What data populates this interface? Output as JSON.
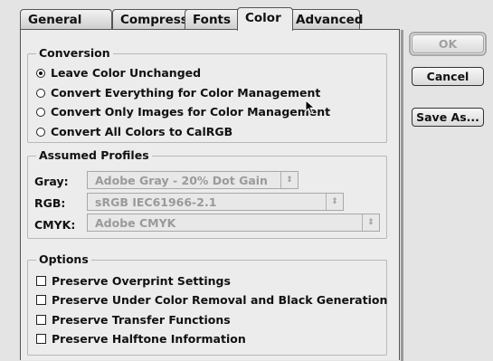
{
  "tabs": [
    "General",
    "Compression",
    "Fonts",
    "Color",
    "Advanced"
  ],
  "active_tab": "Color",
  "conversion": {
    "title": "Conversion",
    "options": [
      {
        "label": "Leave Color Unchanged",
        "selected": true
      },
      {
        "label": "Convert Everything for Color Management",
        "selected": false
      },
      {
        "label": "Convert Only Images for Color Management",
        "selected": false
      },
      {
        "label": "Convert All Colors to CalRGB",
        "selected": false
      }
    ]
  },
  "profiles": {
    "title": "Assumed Profiles",
    "gray": {
      "label": "Gray:",
      "value": "Adobe Gray - 20% Dot Gain"
    },
    "rgb": {
      "label": "RGB:",
      "value": "sRGB IEC61966-2.1"
    },
    "cmyk": {
      "label": "CMYK:",
      "value": "Adobe CMYK"
    }
  },
  "options": {
    "title": "Options",
    "items": [
      {
        "label": "Preserve Overprint Settings",
        "checked": false
      },
      {
        "label": "Preserve Under Color Removal and Black Generation",
        "checked": false
      },
      {
        "label": "Preserve Transfer Functions",
        "checked": false
      },
      {
        "label": "Preserve Halftone Information",
        "checked": false
      }
    ]
  },
  "buttons": {
    "ok": "OK",
    "cancel": "Cancel",
    "save_as": "Save As..."
  },
  "popup_arrows": "⇕"
}
